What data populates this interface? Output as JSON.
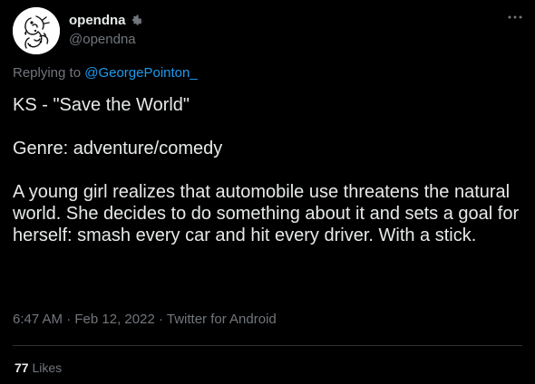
{
  "author": {
    "display_name": "opendna",
    "handle": "@opendna"
  },
  "replying": {
    "prefix": "Replying to ",
    "to": "@GeorgePointon_"
  },
  "tweet": {
    "paragraphs": [
      "KS - \"Save the World\"",
      "Genre: adventure/comedy",
      "A young girl realizes that automobile use threatens the natural world. She decides to do something about it and sets a goal for herself: smash every car and hit every driver. With a stick."
    ],
    "time": "6:47 AM",
    "sep1": " · ",
    "date": "Feb 12, 2022",
    "sep2": " · ",
    "source": "Twitter for Android"
  },
  "stats": {
    "likes_count": "77",
    "likes_label": "Likes"
  },
  "icons": {
    "gear": "gear-icon",
    "more": "more-options-icon",
    "avatar": "avatar"
  },
  "colors": {
    "background": "#000000",
    "text": "#e7e9ea",
    "secondary": "#71767b",
    "link": "#1d9bf0",
    "divider": "#2f3336"
  }
}
